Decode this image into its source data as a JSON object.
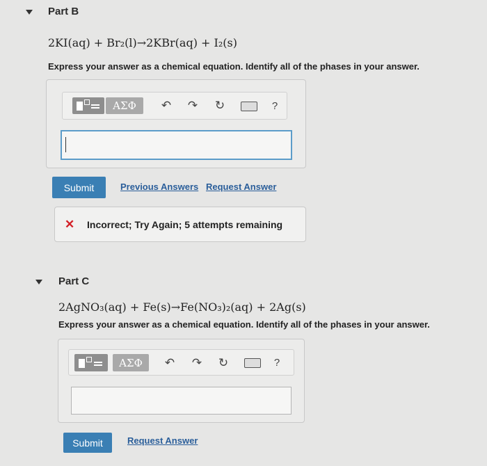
{
  "part_b": {
    "title": "Part B",
    "equation": "2KI(aq) + Br₂(l)→2KBr(aq) + I₂(s)",
    "instructions": "Express your answer as a chemical equation. Identify all of the phases in your answer.",
    "toolbar": {
      "templates_icon": "templates-icon",
      "greek_label": "ΑΣΦ",
      "undo_icon": "↶",
      "redo_icon": "↷",
      "reset_icon": "↻",
      "keyboard_icon": "keyboard-icon",
      "help_label": "?"
    },
    "answer_value": "",
    "submit_label": "Submit",
    "previous_answers_label": "Previous Answers",
    "request_answer_label": "Request Answer",
    "feedback": {
      "icon": "✕",
      "text": "Incorrect; Try Again; 5 attempts remaining"
    }
  },
  "part_c": {
    "title": "Part C",
    "equation": "2AgNO₃(aq) + Fe(s)→Fe(NO₃)₂(aq) + 2Ag(s)",
    "instructions": "Express your answer as a chemical equation. Identify all of the phases in your answer.",
    "toolbar": {
      "templates_icon": "templates-icon",
      "greek_label": "ΑΣΦ",
      "undo_icon": "↶",
      "redo_icon": "↷",
      "reset_icon": "↻",
      "keyboard_icon": "keyboard-icon",
      "help_label": "?"
    },
    "answer_value": "",
    "submit_label": "Submit",
    "request_answer_label": "Request Answer"
  },
  "colors": {
    "background": "#e6e6e5",
    "submit": "#3a7fb4",
    "link": "#2a5e9a",
    "error": "#d31f26",
    "focus_border": "#5b9cc9"
  }
}
